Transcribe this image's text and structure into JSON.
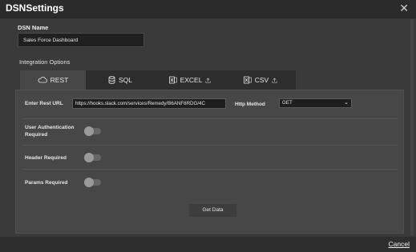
{
  "window": {
    "title": "DSNSettings",
    "close_icon": "close-icon"
  },
  "dsn": {
    "label": "DSN Name",
    "value": "Sales Force Dashboard"
  },
  "integration": {
    "label": "Integration Options",
    "tabs": [
      {
        "label": "REST",
        "icon": "cloud-icon",
        "active": true
      },
      {
        "label": "SQL",
        "icon": "database-icon"
      },
      {
        "label": "EXCEL",
        "icon": "excel-icon"
      },
      {
        "label": "CSV",
        "icon": "csv-icon"
      }
    ]
  },
  "rest": {
    "url_label": "Enter Rest URL",
    "url_value": "https://hooks.slack.com/services/Remedy/B6ANF8RDG/4C",
    "method_label": "Http Method",
    "method_value": "GET",
    "auth_label_1": "User Authentication",
    "auth_label_2": "Required",
    "header_label": "Header Required",
    "params_label": "Params Required",
    "get_button": "Get Data"
  },
  "footer": {
    "cancel": "Cancel"
  }
}
